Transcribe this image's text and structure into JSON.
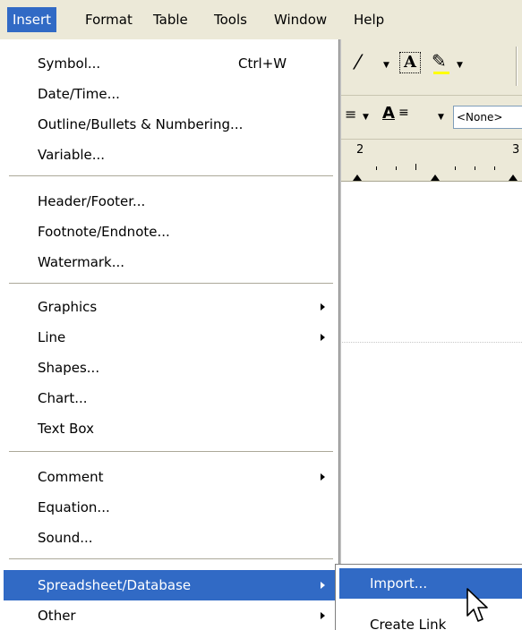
{
  "menubar": {
    "items": [
      "Insert",
      "Format",
      "Table",
      "Tools",
      "Window",
      "Help"
    ]
  },
  "toolbar": {
    "style_value": "<None>",
    "ruler_numbers": [
      "2",
      "3"
    ]
  },
  "insert_menu": {
    "items": [
      {
        "label": "Symbol...",
        "shortcut": "Ctrl+W"
      },
      {
        "label": "Date/Time..."
      },
      {
        "label": "Outline/Bullets & Numbering..."
      },
      {
        "label": "Variable..."
      },
      {
        "label": "Header/Footer..."
      },
      {
        "label": "Footnote/Endnote..."
      },
      {
        "label": "Watermark..."
      },
      {
        "label": "Graphics"
      },
      {
        "label": "Line"
      },
      {
        "label": "Shapes..."
      },
      {
        "label": "Chart..."
      },
      {
        "label": "Text Box"
      },
      {
        "label": "Comment"
      },
      {
        "label": "Equation..."
      },
      {
        "label": "Sound..."
      },
      {
        "label": "Spreadsheet/Database"
      },
      {
        "label": "Other"
      }
    ]
  },
  "submenu": {
    "items": [
      {
        "label": "Import..."
      },
      {
        "label": "Create Link"
      }
    ]
  },
  "colors": {
    "highlight": "#316ac5",
    "menubar_bg": "#ece9d8"
  }
}
